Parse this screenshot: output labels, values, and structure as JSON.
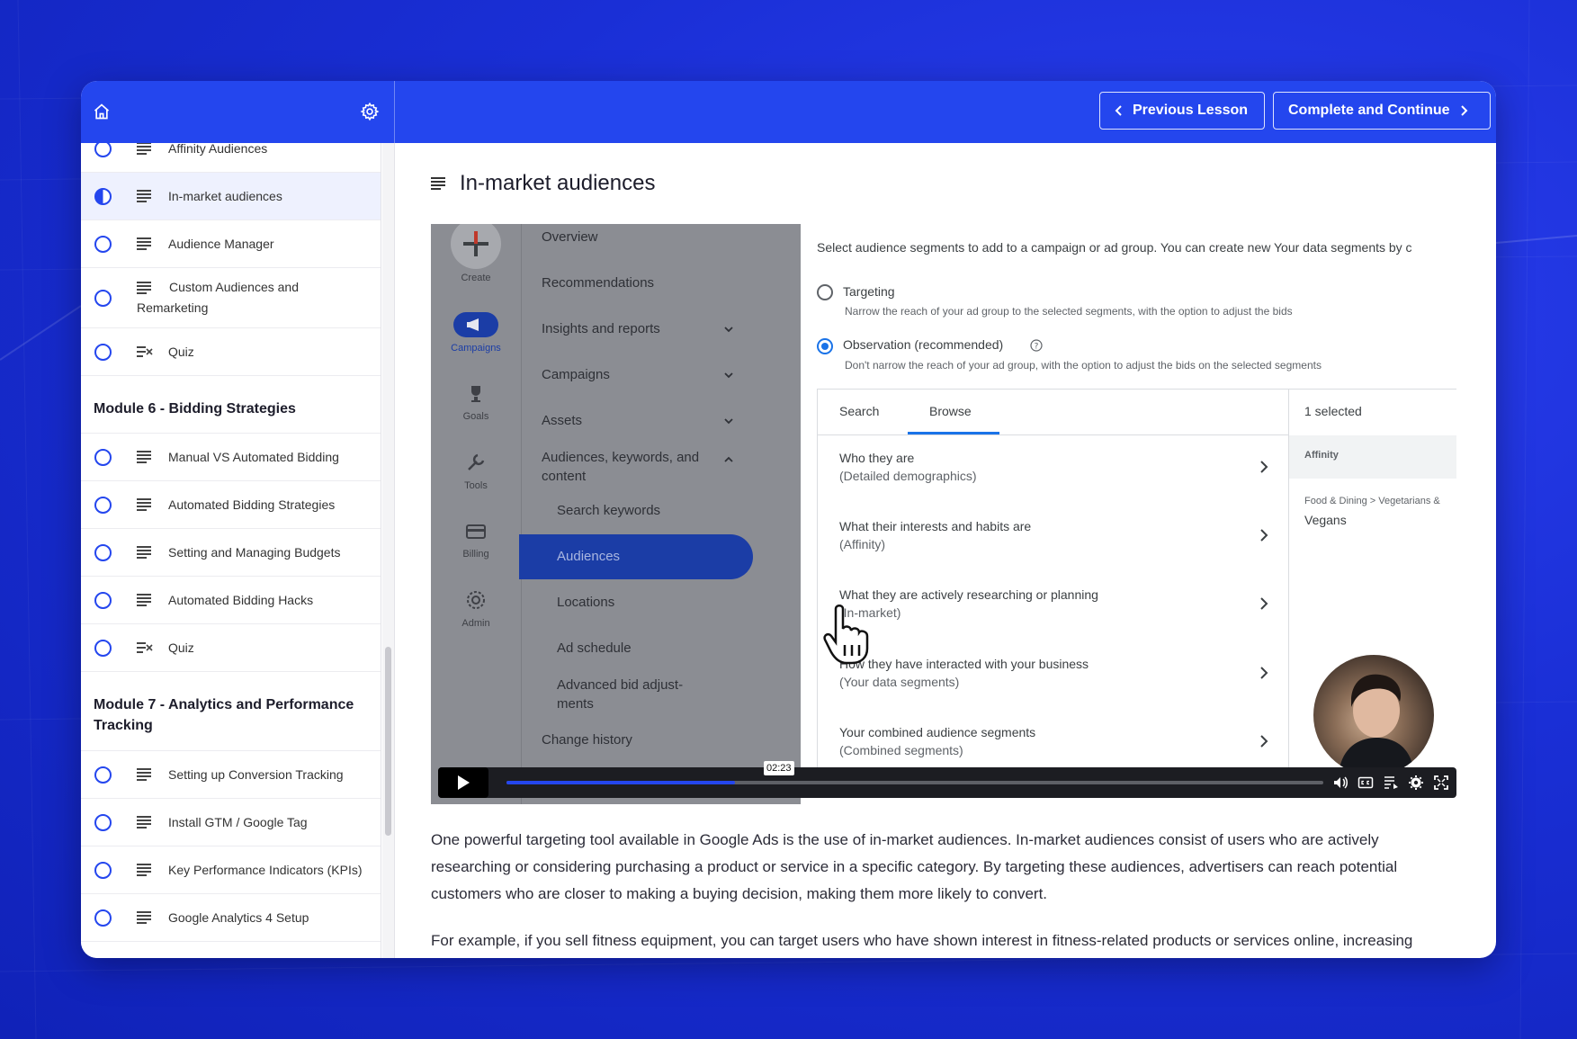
{
  "header": {
    "prev_label": "Previous Lesson",
    "next_label": "Complete and Continue"
  },
  "sidebar": {
    "lessons_a": [
      {
        "label": "Affinity Audiences",
        "status": "empty",
        "type": "text"
      },
      {
        "label": "In-market audiences",
        "status": "half",
        "type": "text",
        "active": true
      },
      {
        "label": "Audience Manager",
        "status": "empty",
        "type": "text"
      },
      {
        "label": "Custom Audiences and Remarketing",
        "status": "empty",
        "type": "text"
      },
      {
        "label": "Quiz",
        "status": "empty",
        "type": "quiz"
      }
    ],
    "module6": "Module 6 - Bidding Strategies",
    "lessons_b": [
      {
        "label": "Manual VS Automated Bidding"
      },
      {
        "label": "Automated Bidding Strategies"
      },
      {
        "label": "Setting and Managing Budgets"
      },
      {
        "label": "Automated Bidding Hacks"
      },
      {
        "label": "Quiz"
      }
    ],
    "module7": "Module 7 - Analytics and Performance Tracking",
    "lessons_c": [
      {
        "label": "Setting up Conversion Tracking"
      },
      {
        "label": "Install GTM / Google Tag"
      },
      {
        "label": "Key Performance Indicators (KPIs)"
      },
      {
        "label": "Google Analytics 4 Setup"
      }
    ]
  },
  "lesson": {
    "title": "In-market audiences",
    "paragraph1": "One powerful targeting tool available in Google Ads is the use of in-market audiences. In-market audiences consist of users who are actively researching or considering purchasing a product or service in a specific category. By targeting these audiences, advertisers can reach potential customers who are closer to making a buying decision, making them more likely to convert.",
    "paragraph2": "For example, if you sell fitness equipment, you can target users who have shown interest in fitness-related products or services online, increasing"
  },
  "video": {
    "rail": [
      "Create",
      "Campaigns",
      "Goals",
      "Tools",
      "Billing",
      "Admin"
    ],
    "nav": {
      "overview": "Overview",
      "recommendations": "Recommendations",
      "insights": "Insights and reports",
      "campaigns": "Campaigns",
      "assets": "Assets",
      "audiences_group": "Audiences, keywords, and content",
      "search_keywords": "Search keywords",
      "audiences": "Audiences",
      "locations": "Locations",
      "ad_schedule": "Ad schedule",
      "advanced_bid": "Advanced bid adjust- ments",
      "change_history": "Change history"
    },
    "intro": "Select audience segments to add to a campaign or ad group. You can create new Your data segments by c",
    "targeting": "Targeting",
    "targeting_desc": "Narrow the reach of your ad group to the selected segments, with the option to adjust the bids",
    "observation": "Observation (recommended)",
    "observation_desc": "Don't narrow the reach of your ad group, with the option to adjust the bids on the selected segments",
    "tab_search": "Search",
    "tab_browse": "Browse",
    "selected": "1 selected",
    "affinity": "Affinity",
    "crumb": "Food & Dining > Vegetarians &",
    "vegans": "Vegans",
    "rows": [
      {
        "title": "Who they are",
        "sub": "(Detailed demographics)"
      },
      {
        "title": "What their interests and habits are",
        "sub": "(Affinity)"
      },
      {
        "title": "What they are actively researching or planning",
        "sub": "(In-market)"
      },
      {
        "title": "How they have interacted with your business",
        "sub": "(Your data segments)"
      },
      {
        "title": "Your combined audience segments",
        "sub": "(Combined segments)"
      }
    ],
    "time": "02:23",
    "progress": 0.28
  },
  "colors": {
    "brand": "#2446ee",
    "background": "#1a2fd6"
  }
}
